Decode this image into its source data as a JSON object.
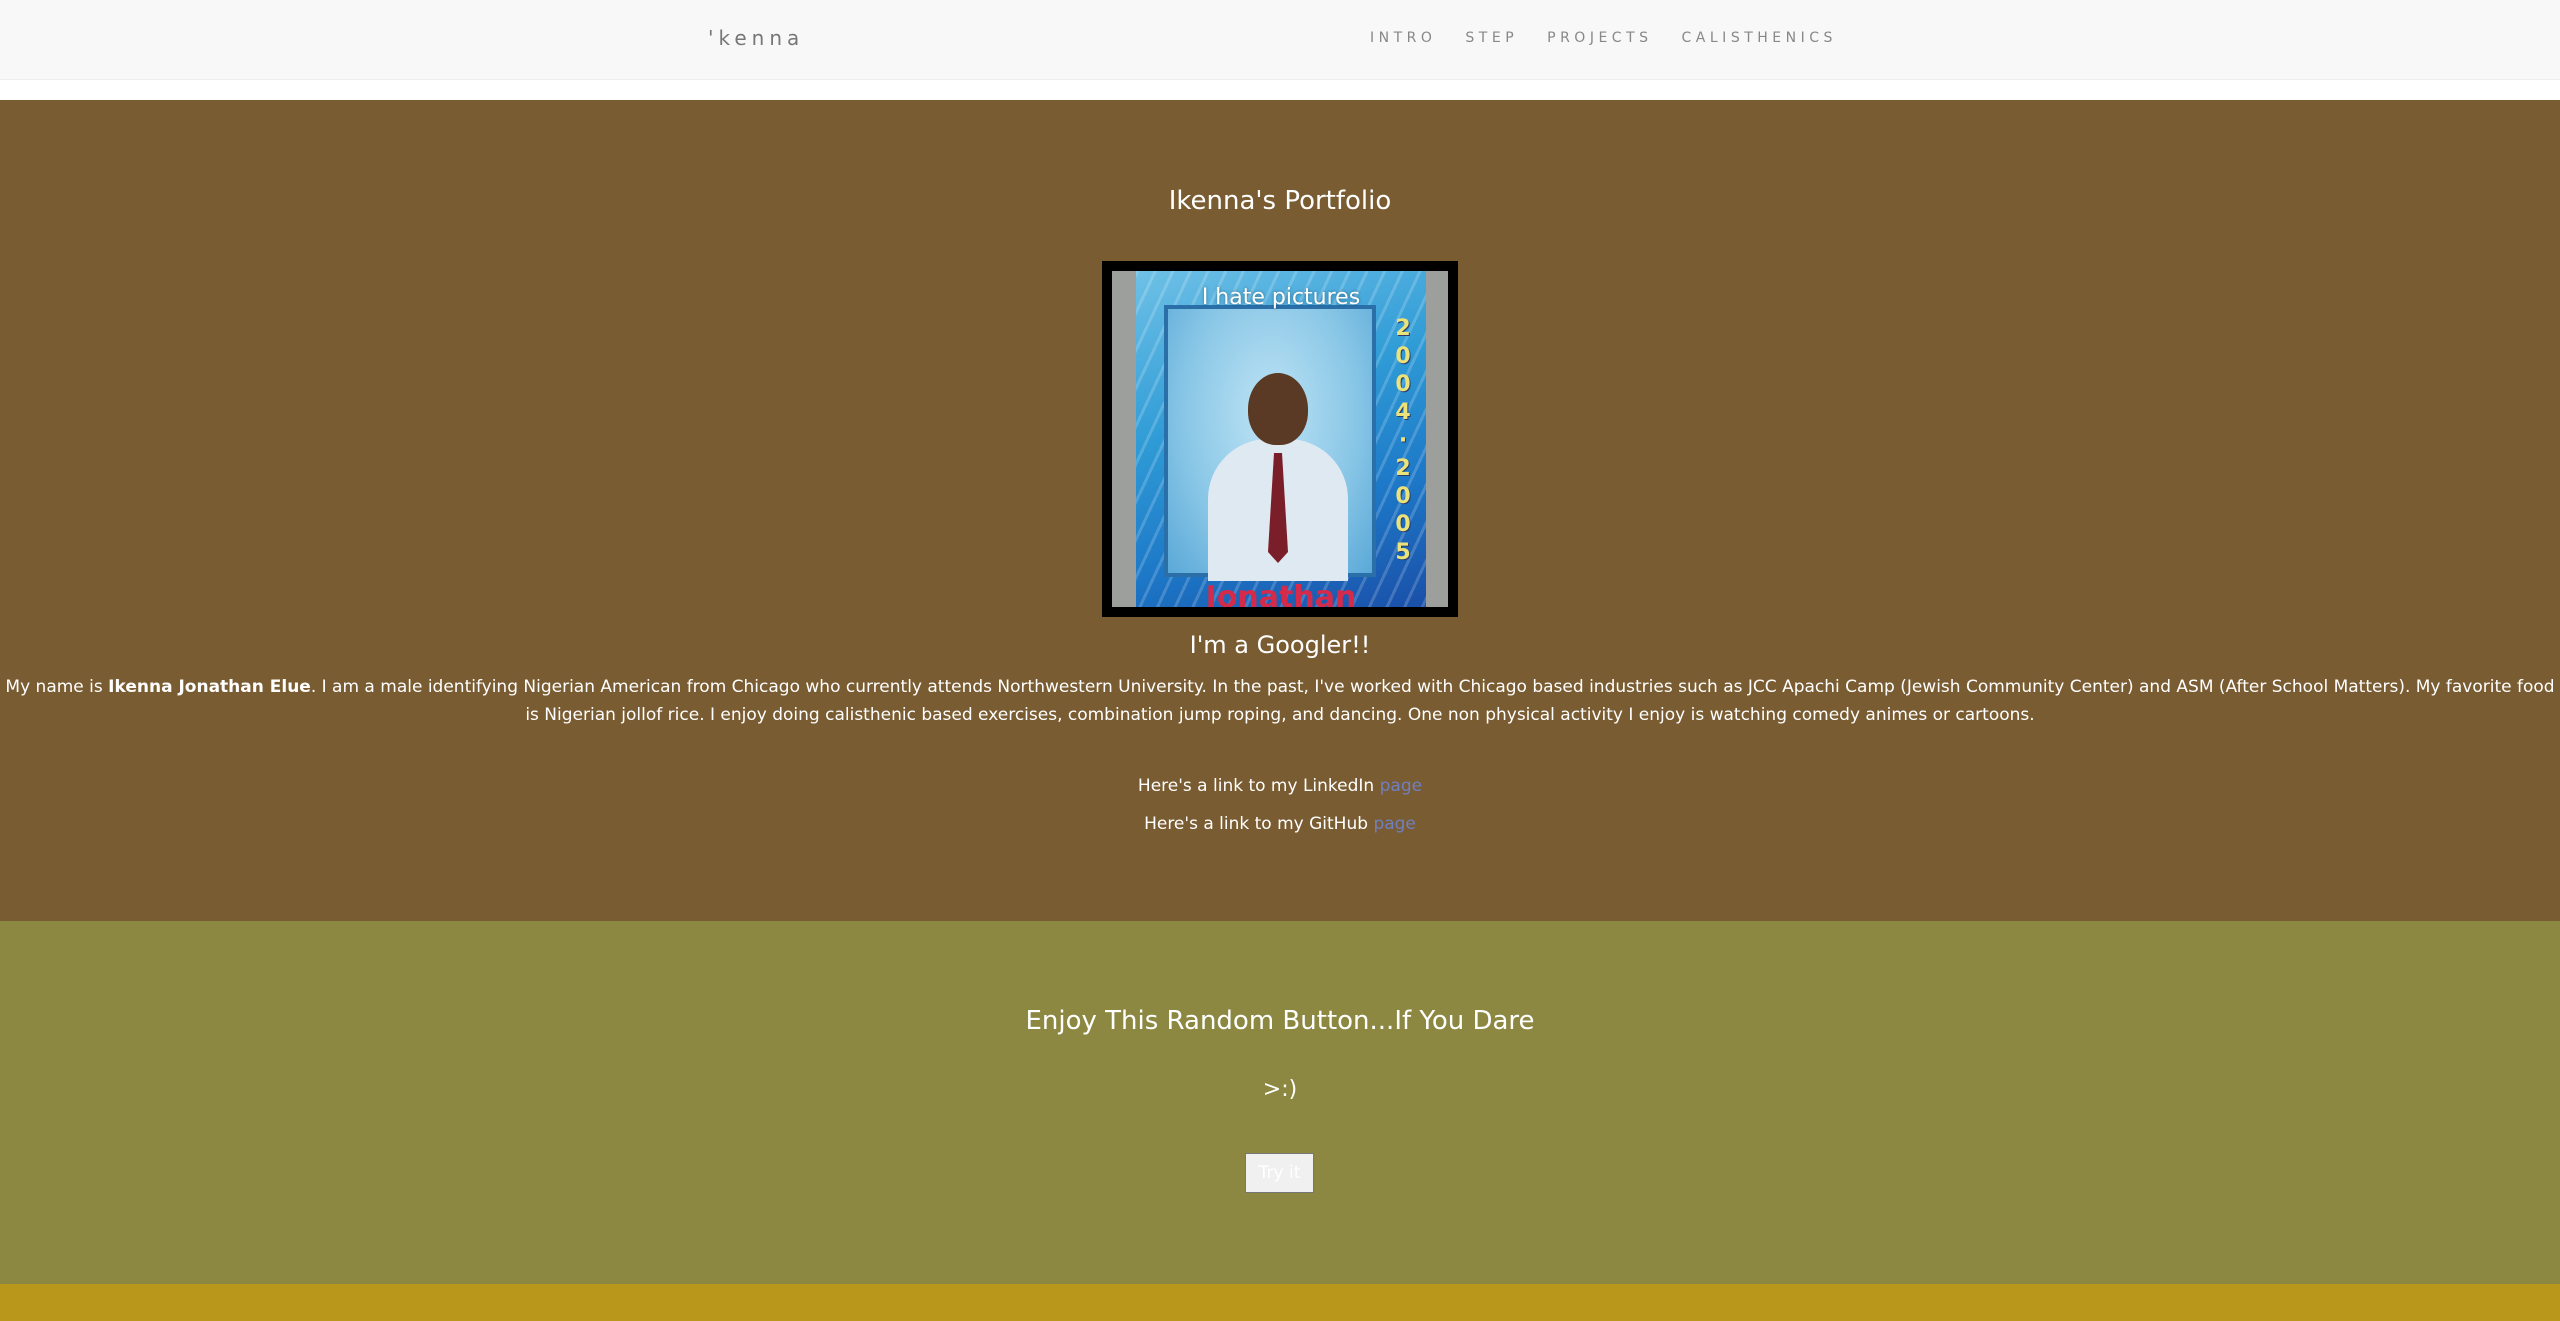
{
  "navbar": {
    "brand": "'kenna",
    "links": [
      "INTRO",
      "STEP",
      "PROJECTS",
      "CALISTHENICS"
    ]
  },
  "intro": {
    "title": "Ikenna's Portfolio",
    "photo": {
      "caption": "I hate pictures",
      "years": "2004 · 2005",
      "name": "Jonathan"
    },
    "googler": "I'm a Googler!!",
    "bio_prefix": "My name is ",
    "bio_name": "Ikenna Jonathan Elue",
    "bio_rest": ". I am a male identifying Nigerian American from Chicago who currently attends Northwestern University. In the past, I've worked with Chicago based industries such as JCC Apachi Camp (Jewish Community Center) and ASM (After School Matters). My favorite food is Nigerian jollof rice. I enjoy doing calisthenic based exercises, combination jump roping, and dancing. One non physical activity I enjoy is watching comedy animes or cartoons.",
    "linkedin_text": "Here's a link to my LinkedIn ",
    "linkedin_link": "page",
    "github_text": "Here's a link to my GitHub ",
    "github_link": "page"
  },
  "button_section": {
    "title": "Enjoy This Random Button...If You Dare",
    "face": ">:)",
    "button_label": "Try it"
  },
  "colors": {
    "intro_bg": "#7a5c32",
    "button_section_bg": "#8c8842",
    "bottom_strip": "#b8971a",
    "link": "#6f7fc0"
  }
}
